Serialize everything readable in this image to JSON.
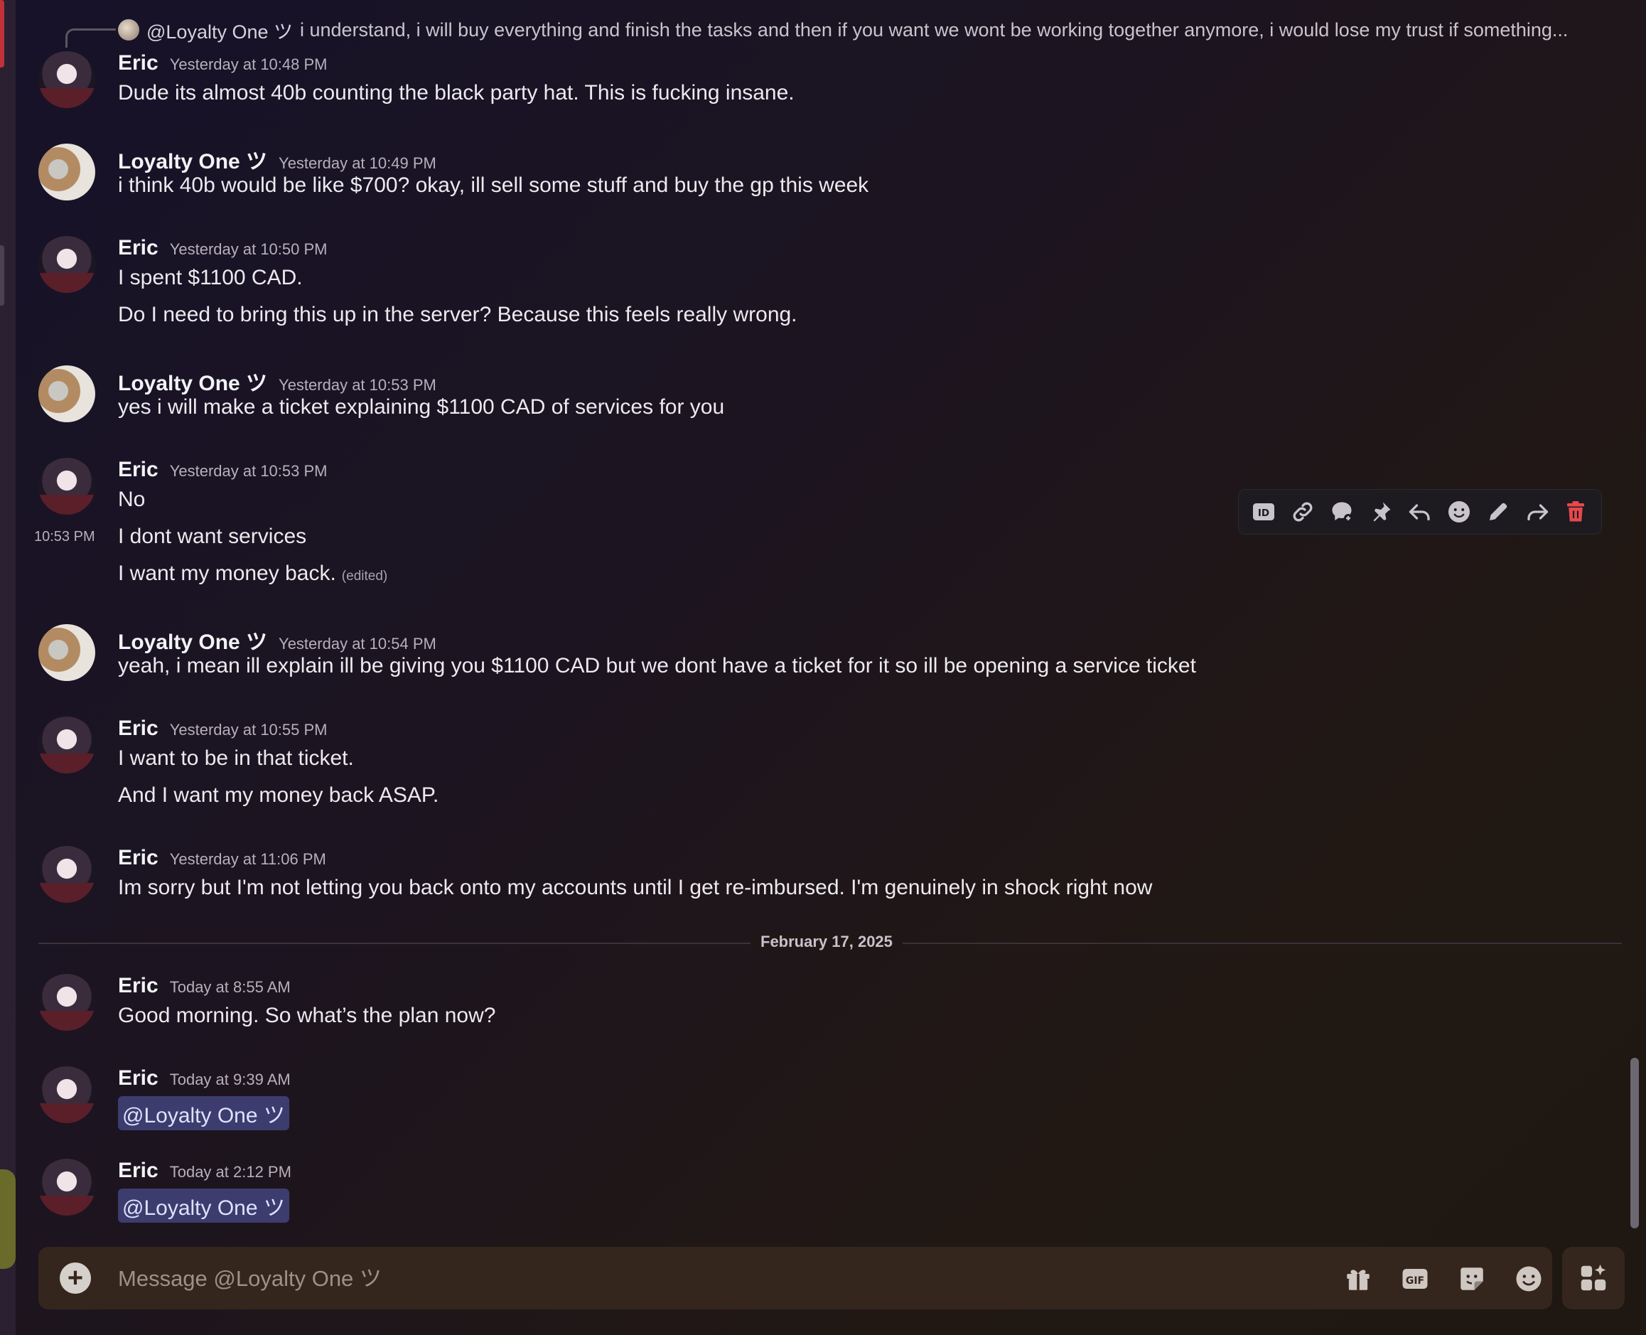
{
  "reply_reference": {
    "mention": "@Loyalty One ツ",
    "text": "i understand, i will buy everything and finish the tasks and then if you want we wont be working together anymore, i would lose my trust if something..."
  },
  "messages": [
    {
      "author": "Eric",
      "timestamp": "Yesterday at 10:48 PM",
      "lines": [
        "Dude its almost 40b counting the black party hat. This is fucking insane."
      ]
    },
    {
      "author": "Loyalty One ツ",
      "timestamp": "Yesterday at 10:49 PM",
      "lines": [
        "i think 40b would be like $700? okay, ill sell some stuff and buy the gp this week"
      ]
    },
    {
      "author": "Eric",
      "timestamp": "Yesterday at 10:50 PM",
      "lines": [
        "I spent $1100 CAD.",
        "Do I need to bring this up in the server? Because this feels really wrong."
      ]
    },
    {
      "author": "Loyalty One ツ",
      "timestamp": "Yesterday at 10:53 PM",
      "lines": [
        "yes i will make a ticket explaining $1100 CAD of services for you"
      ]
    },
    {
      "author": "Eric",
      "timestamp": "Yesterday at 10:53 PM",
      "hover_time": "10:53 PM",
      "lines": [
        "No",
        "I dont want services",
        "I want my money back."
      ],
      "edited_label": "(edited)"
    },
    {
      "author": "Loyalty One ツ",
      "timestamp": "Yesterday at 10:54 PM",
      "lines": [
        "yeah, i mean ill explain ill be giving you $1100 CAD but we dont have a ticket for it so ill be opening a service ticket"
      ]
    },
    {
      "author": "Eric",
      "timestamp": "Yesterday at 10:55 PM",
      "lines": [
        "I want to be in that ticket.",
        "And I want my money back ASAP."
      ]
    },
    {
      "author": "Eric",
      "timestamp": "Yesterday at 11:06 PM",
      "lines": [
        "Im sorry but I'm not letting you back onto my accounts until I get re-imbursed. I'm genuinely in shock right now"
      ]
    },
    {
      "author": "Eric",
      "timestamp": "Today at 8:55 AM",
      "lines": [
        "Good morning. So what’s the plan now?"
      ]
    },
    {
      "author": "Eric",
      "timestamp": "Today at 9:39 AM",
      "mention": "@Loyalty One ツ"
    },
    {
      "author": "Eric",
      "timestamp": "Today at 2:12 PM",
      "mention": "@Loyalty One ツ"
    }
  ],
  "date_divider": "February 17, 2025",
  "toolbar_icons": [
    "id-icon",
    "link-icon",
    "thread-icon",
    "pin-icon",
    "reply-icon",
    "reaction-icon",
    "edit-icon",
    "forward-icon",
    "delete-icon"
  ],
  "composer": {
    "placeholder": "Message @Loyalty One ツ",
    "icons": [
      "gift-icon",
      "gif-icon",
      "sticker-icon",
      "emoji-icon"
    ]
  },
  "colors": {
    "delete": "#e5484d",
    "mention_bg": "#3c3d6e"
  }
}
